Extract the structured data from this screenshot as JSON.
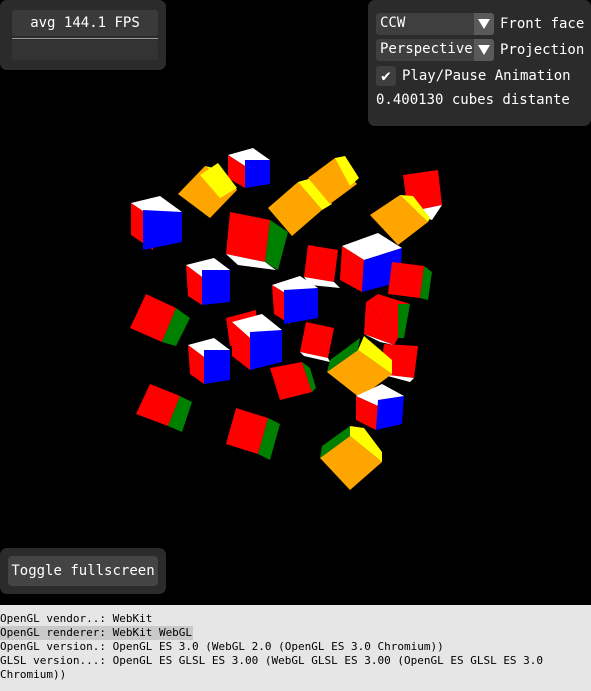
{
  "fps": {
    "text": "avg 144.1 FPS"
  },
  "options": {
    "front_face_value": "CCW",
    "front_face_label": "Front face",
    "projection_value": "Perspective",
    "projection_label": "Projection",
    "play_pause_checked": true,
    "play_pause_label": "Play/Pause Animation",
    "distance_text": "0.400130 cubes distante"
  },
  "fullscreen": {
    "label": "Toggle fullscreen"
  },
  "info": {
    "vendor": "OpenGL vendor..: WebKit",
    "renderer": "OpenGL renderer: WebKit WebGL",
    "version": "OpenGL version.: OpenGL ES 3.0 (WebGL 2.0 (OpenGL ES 3.0 Chromium))",
    "glsl": "GLSL version...: OpenGL ES GLSL ES 3.00 (WebGL GLSL ES 3.00 (OpenGL ES GLSL ES 3.0 Chromium))"
  },
  "colors": {
    "red": "#ff0000",
    "blue": "#0000ff",
    "green": "#008000",
    "yellow": "#ffff00",
    "orange": "#ffa500",
    "white": "#ffffff"
  }
}
